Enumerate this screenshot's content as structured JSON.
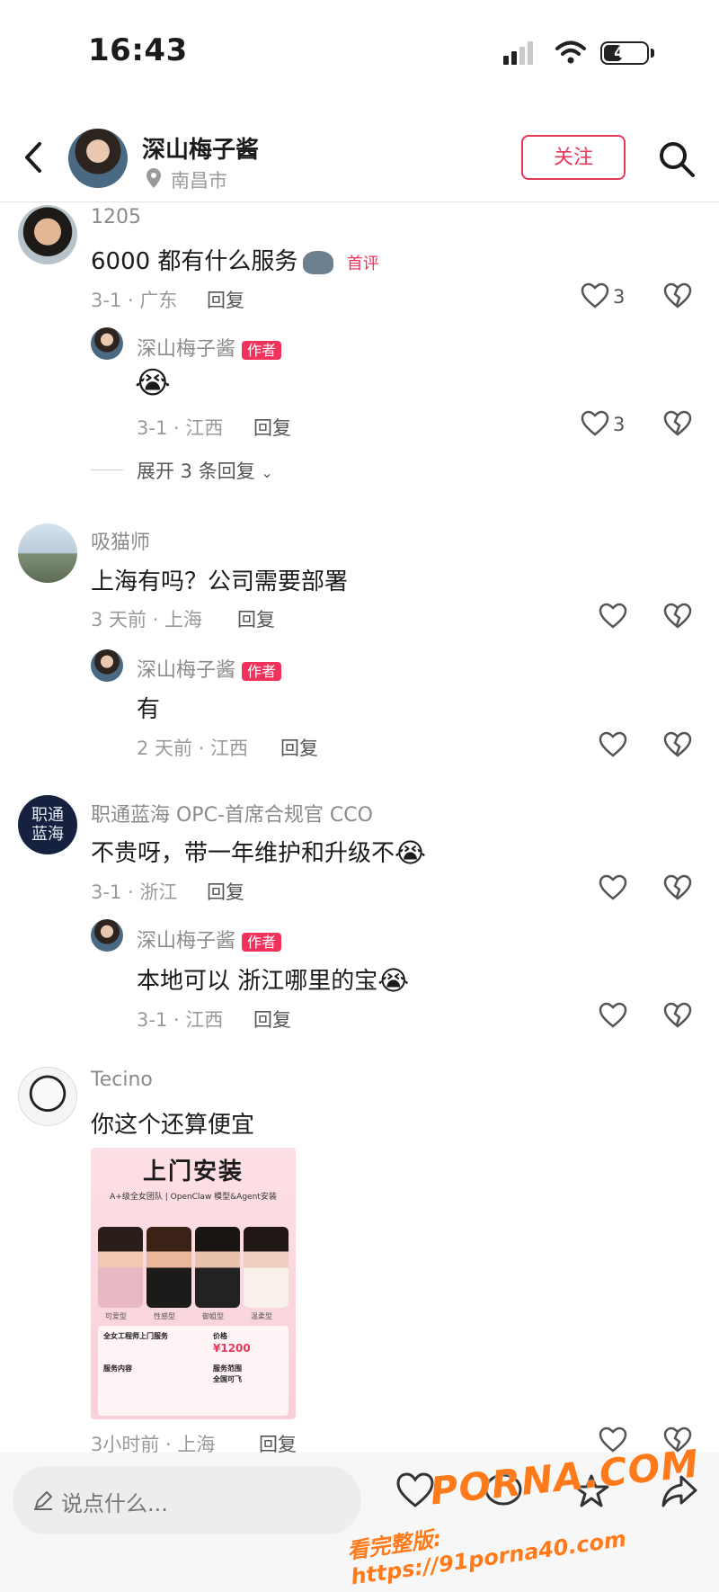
{
  "status_bar": {
    "time": "16:43",
    "battery": "40"
  },
  "header": {
    "username": "深山梅子酱",
    "location": "南昌市",
    "follow_label": "关注"
  },
  "comments": [
    {
      "username": "1205",
      "text": "6000 都有什么服务",
      "tag": "首评",
      "time_loc": "3-1 · 广东",
      "reply_label": "回复",
      "likes": "3",
      "reply": {
        "username": "深山梅子酱",
        "badge": "作者",
        "time_loc": "3-1 · 江西",
        "reply_label": "回复",
        "likes": "3"
      },
      "expand_label": "展开 3 条回复"
    },
    {
      "username": "吸猫师",
      "text": "上海有吗？公司需要部署",
      "time_loc": "3 天前 · 上海",
      "reply_label": "回复",
      "reply": {
        "username": "深山梅子酱",
        "badge": "作者",
        "text": "有",
        "time_loc": "2 天前 · 江西",
        "reply_label": "回复"
      }
    },
    {
      "username": "职通蓝海 OPC-首席合规官 CCO",
      "avatar_text": "职通\n蓝海",
      "text": "不贵呀，带一年维护和升级不",
      "time_loc": "3-1 · 浙江",
      "reply_label": "回复",
      "reply": {
        "username": "深山梅子酱",
        "badge": "作者",
        "text": "本地可以 浙江哪里的宝",
        "time_loc": "3-1 · 江西",
        "reply_label": "回复"
      }
    },
    {
      "username": "Tecino",
      "text": "你这个还算便宜",
      "time_loc": "3小时前 · 上海",
      "reply_label": "回复",
      "image": {
        "title": "上门安装",
        "subtitle": "A+级全女团队 | OpenClaw 模型&Agent安装",
        "labels": [
          "可爱型",
          "性感型",
          "御姐型",
          "温柔型"
        ],
        "left_heading": "全女工程师上门服务",
        "price_label": "价格",
        "price": "¥1200",
        "scope_label": "服务范围",
        "scope": "全国可飞",
        "content_label": "服务内容"
      }
    }
  ],
  "bottom_bar": {
    "input_placeholder": "说点什么..."
  },
  "watermark": {
    "line1": "PORNA.COM",
    "line2": "看完整版: https://91porna40.com"
  }
}
